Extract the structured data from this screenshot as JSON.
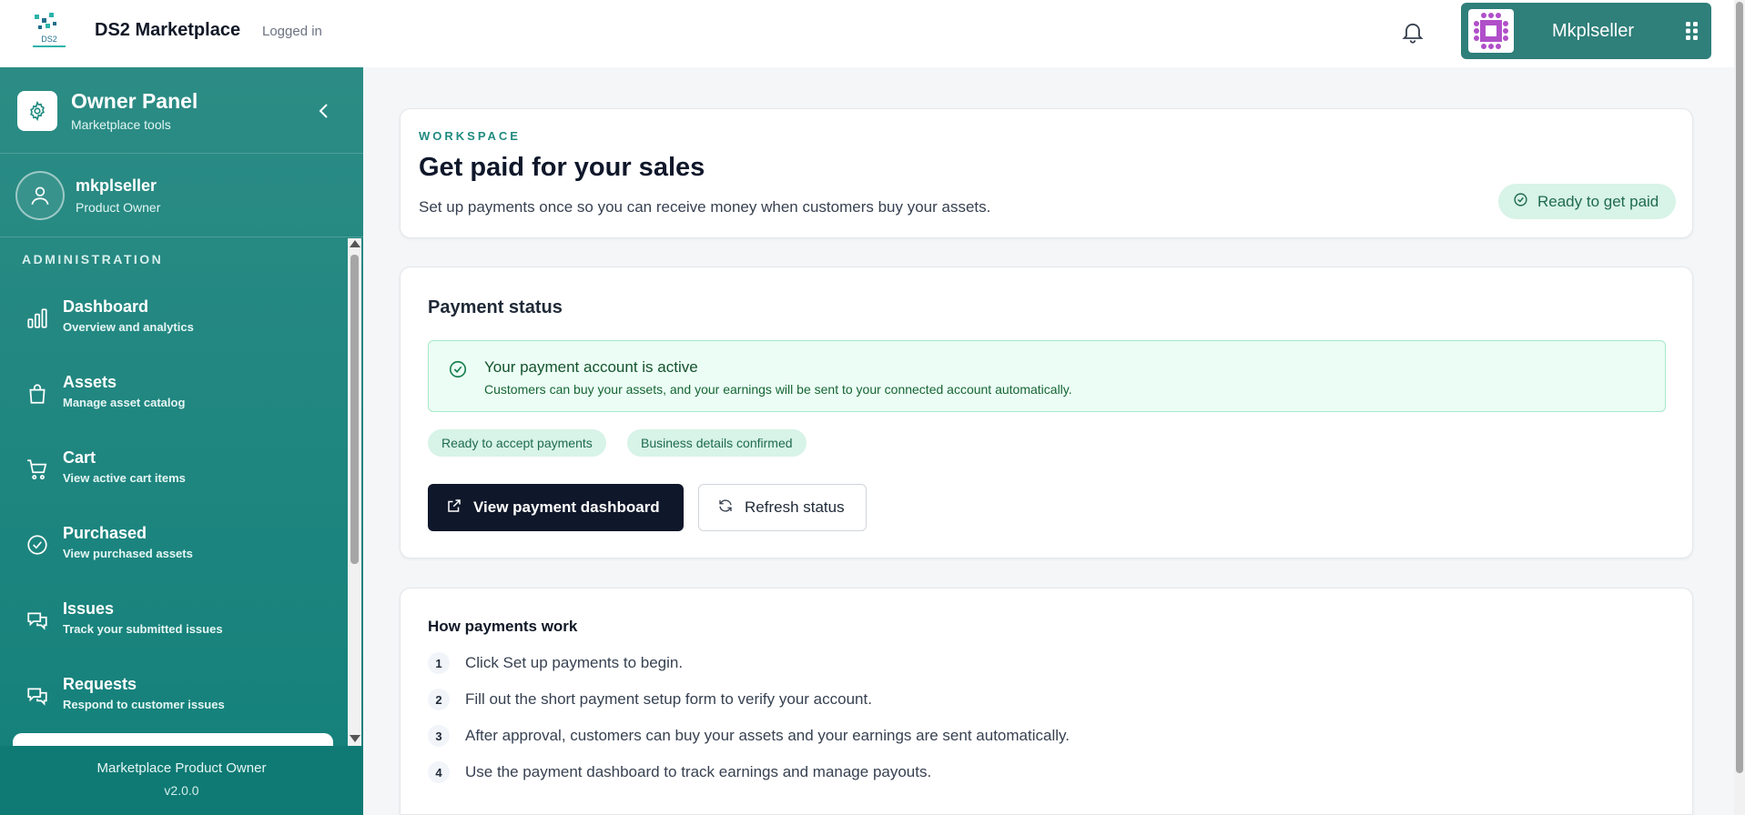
{
  "header": {
    "brand": "DS2 Marketplace",
    "status": "Logged in",
    "user_name": "Mkplseller",
    "logo_icon": "ds2-logo",
    "bell_icon": "bell-icon",
    "menu_icon": "grid-dots-icon"
  },
  "sidebar": {
    "panel_title": "Owner Panel",
    "panel_subtitle": "Marketplace tools",
    "owner_name": "mkplseller",
    "owner_role": "Product Owner",
    "section_label": "ADMINISTRATION",
    "items": [
      {
        "label": "Dashboard",
        "desc": "Overview and analytics",
        "icon": "bar-chart-icon"
      },
      {
        "label": "Assets",
        "desc": "Manage asset catalog",
        "icon": "shopping-bag-icon"
      },
      {
        "label": "Cart",
        "desc": "View active cart items",
        "icon": "cart-icon"
      },
      {
        "label": "Purchased",
        "desc": "View purchased assets",
        "icon": "check-circle-icon"
      },
      {
        "label": "Issues",
        "desc": "Track your submitted issues",
        "icon": "chat-bubbles-icon"
      },
      {
        "label": "Requests",
        "desc": "Respond to customer issues",
        "icon": "chat-bubbles-icon"
      }
    ],
    "footer_title": "Marketplace Product Owner",
    "footer_version": "v2.0.0"
  },
  "workspace": {
    "eyebrow": "WORKSPACE",
    "title": "Get paid for your sales",
    "description": "Set up payments once so you can receive money when customers buy your assets.",
    "status_pill": "Ready to get paid"
  },
  "payment_status": {
    "title": "Payment status",
    "banner_title": "Your payment account is active",
    "banner_desc": "Customers can buy your assets, and your earnings will be sent to your connected account automatically.",
    "chips": [
      "Ready to accept payments",
      "Business details confirmed"
    ],
    "primary_button": "View payment dashboard",
    "secondary_button": "Refresh status"
  },
  "how_payments": {
    "title": "How payments work",
    "steps": [
      {
        "num": "1",
        "text": "Click Set up payments to begin."
      },
      {
        "num": "2",
        "text": "Fill out the short payment setup form to verify your account."
      },
      {
        "num": "3",
        "text": "After approval, customers can buy your assets and your earnings are sent automatically."
      },
      {
        "num": "4",
        "text": "Use the payment dashboard to track earnings and manage payouts."
      }
    ]
  },
  "colors": {
    "sidebar_teal": "#13807a",
    "accent_green": "#1f8b80",
    "dark_button": "#0f172a",
    "pill_bg": "#d8f3e8"
  }
}
